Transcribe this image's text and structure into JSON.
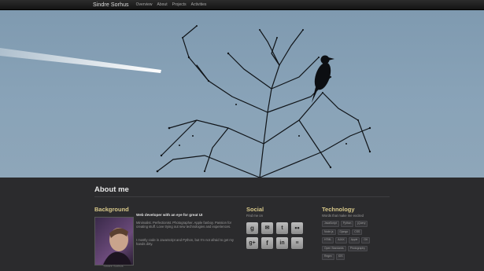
{
  "nav": {
    "brand": "Sindre Sorhus",
    "links": [
      "Overview",
      "About",
      "Projects",
      "Activities"
    ]
  },
  "about": {
    "title": "About me",
    "background": {
      "title": "Background",
      "headline": "Web developer with an eye for great UI",
      "para1": "Minimalist. Perfectionist. Photographer. Apple fanboy. Passion for creating stuff. Love trying out new technologies and experiences.",
      "para2": "I mostly code in JavaScript and Python, but I'm not afraid to get my hands dirty.",
      "photo_caption": "Sindre Sorhus"
    },
    "social": {
      "title": "Social",
      "subtitle": "Find me on",
      "icons": [
        "google",
        "gmail",
        "twitter",
        "flickr",
        "google-plus",
        "facebook",
        "linkedin",
        "stackoverflow"
      ]
    },
    "technology": {
      "title": "Technology",
      "subtitle": "Words that make me excited",
      "tags": [
        "JavaScript",
        "Python",
        "jQuery",
        "Node.js",
        "Django",
        "CSS",
        "HTML",
        "AJAX",
        "Apple",
        "Git",
        "Open Standards",
        "Photography",
        "Regex",
        "iOS"
      ]
    }
  },
  "colors": {
    "accent": "#d9c98a",
    "background": "#2b2b2d",
    "sky": "#86a0b5"
  }
}
